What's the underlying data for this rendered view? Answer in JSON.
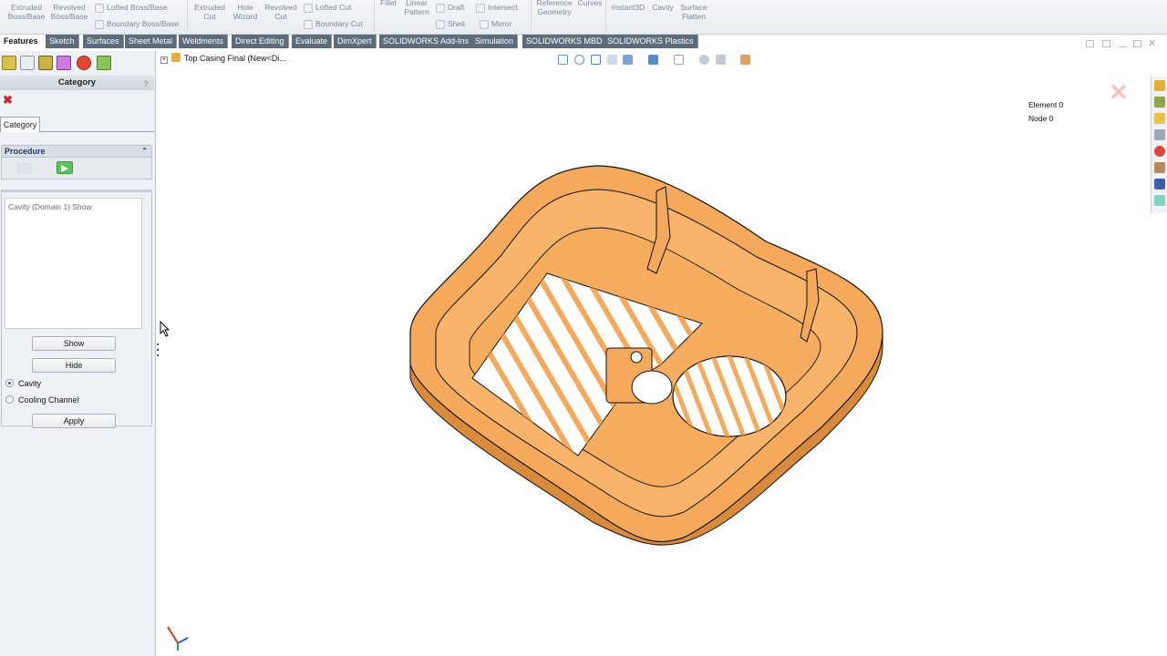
{
  "ribbon": {
    "items": [
      {
        "line1": "Extruded",
        "line2": "Boss/Base"
      },
      {
        "line1": "Revolved",
        "line2": "Boss/Base"
      },
      {
        "line1": "Lofted Boss/Base",
        "line2": "Boundary Boss/Base"
      },
      {
        "line1": "Extruded",
        "line2": "Cut"
      },
      {
        "line1": "Hole",
        "line2": "Wizard"
      },
      {
        "line1": "Revolved",
        "line2": "Cut"
      },
      {
        "line1": "Lofted Cut",
        "line2": "Boundary Cut"
      },
      {
        "line1": "Fillet",
        "line2": ""
      },
      {
        "line1": "Linear",
        "line2": "Pattern"
      },
      {
        "line1": "Draft",
        "line2": "Shell"
      },
      {
        "line1": "Intersect",
        "line2": "Mirror"
      },
      {
        "line1": "Reference",
        "line2": "Geometry"
      },
      {
        "line1": "Curves",
        "line2": ""
      },
      {
        "line1": "Instant3D",
        "line2": ""
      },
      {
        "line1": "Cavity",
        "line2": ""
      },
      {
        "line1": "Surface",
        "line2": "Flatten"
      }
    ]
  },
  "tabs": [
    "Features",
    "Sketch",
    "Surfaces",
    "Sheet Metal",
    "Weldments",
    "Direct Editing",
    "Evaluate",
    "DimXpert",
    "SOLIDWORKS Add-Ins",
    "Simulation",
    "SOLIDWORKS MBD",
    "SOLIDWORKS Plastics"
  ],
  "panel": {
    "header": "Category",
    "help": "?",
    "subtab": "Category",
    "procedure_header": "Procedure",
    "list_items": [
      "Cavity (Domain 1) Show"
    ],
    "show_button": "Show",
    "hide_button": "Hide",
    "radio_options": [
      "Cavity",
      "Cooling Channel"
    ],
    "radio_selected": "Cavity",
    "apply_button": "Apply"
  },
  "viewport": {
    "tree_label": "Top Casing Final  (New<Di...",
    "status": {
      "element": "Element 0",
      "node": "Node 0"
    },
    "model_color": "#f4a95c"
  },
  "colors": {
    "accent_tab": "#5d6b7b",
    "close_red": "#d2232a",
    "procedure_text": "#253a5a"
  }
}
